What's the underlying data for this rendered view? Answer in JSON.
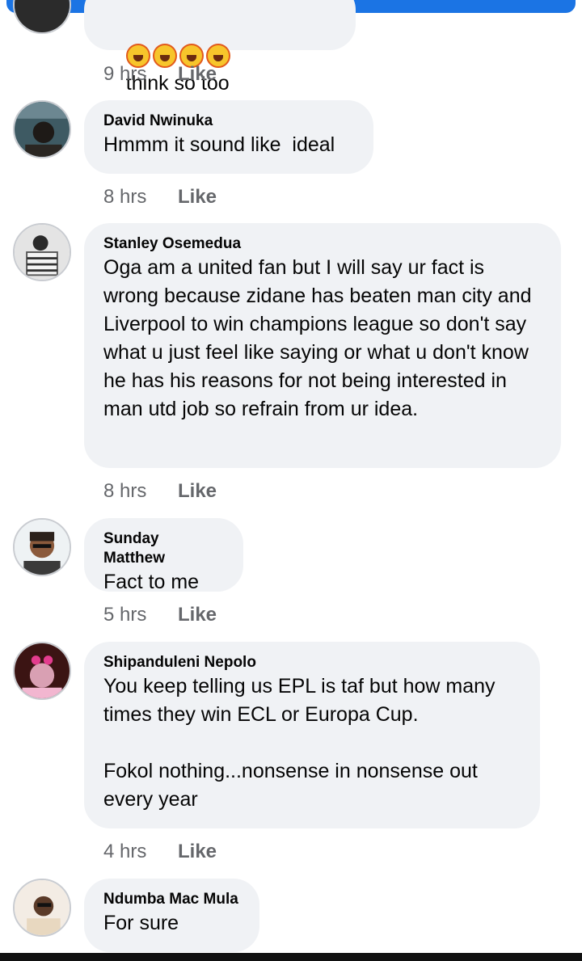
{
  "colors": {
    "bubble": "#f0f2f5",
    "meta_text": "#65676b",
    "header_bar": "#1b74e4"
  },
  "comments": [
    {
      "name": "",
      "emojis": [
        "laughing-emoji",
        "laughing-emoji",
        "laughing-emoji",
        "laughing-emoji"
      ],
      "text": "think so too",
      "time": "9 hrs",
      "like": "Like"
    },
    {
      "name": "David Nwinuka",
      "text": "Hmmm it sound like  ideal",
      "time": "8 hrs",
      "like": "Like"
    },
    {
      "name": "Stanley Osemedua",
      "text": "Oga am a united fan but I will say ur fact is wrong because zidane has beaten man city and Liverpool to win champions league so don't say what u just feel like saying or what u don't know he has his reasons for not being interested in man utd job so refrain from ur idea.",
      "time": "8 hrs",
      "like": "Like"
    },
    {
      "name": "Sunday Matthew",
      "text": "Fact to me",
      "time": "5 hrs",
      "like": "Like"
    },
    {
      "name": "Shipanduleni Nepolo",
      "text": "You keep telling us EPL is taf but how many times they win ECL or Europa Cup.\n\nFokol nothing...nonsense in nonsense out every year",
      "time": "4 hrs",
      "like": "Like"
    },
    {
      "name": "Ndumba Mac Mula",
      "text": "For sure",
      "time": "",
      "like": ""
    }
  ]
}
